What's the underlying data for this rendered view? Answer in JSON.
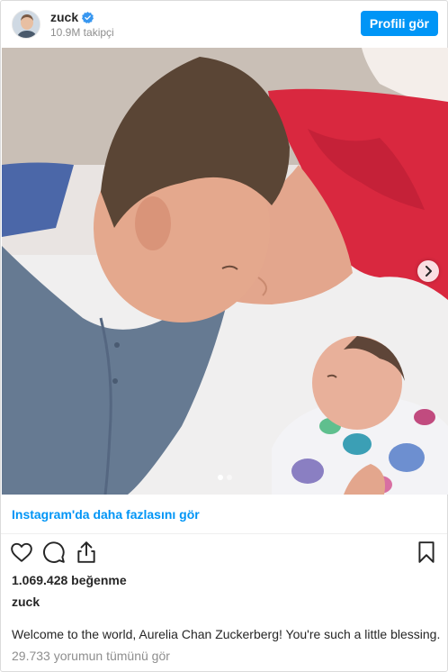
{
  "header": {
    "username": "zuck",
    "followers": "10.9M takipçi",
    "view_profile_label": "Profili gör"
  },
  "post": {
    "more_link": "Instagram'da daha fazlasını gör",
    "likes": "1.069.428 beğenme",
    "caption_user": "zuck",
    "caption": "Welcome to the world, Aurelia Chan Zuckerberg! You're such a little blessing.",
    "comments": "29.733 yorumun tümünü gör",
    "carousel": {
      "slide_count": 2,
      "active_index": 0
    }
  },
  "icons": {
    "verified": "verified-badge-icon",
    "like": "heart-icon",
    "comment": "comment-icon",
    "share": "share-icon",
    "save": "bookmark-icon",
    "next": "chevron-right-icon"
  },
  "colors": {
    "accent": "#0095f6",
    "text": "#262626",
    "muted": "#8e8e8e",
    "border": "#dbdbdb"
  }
}
